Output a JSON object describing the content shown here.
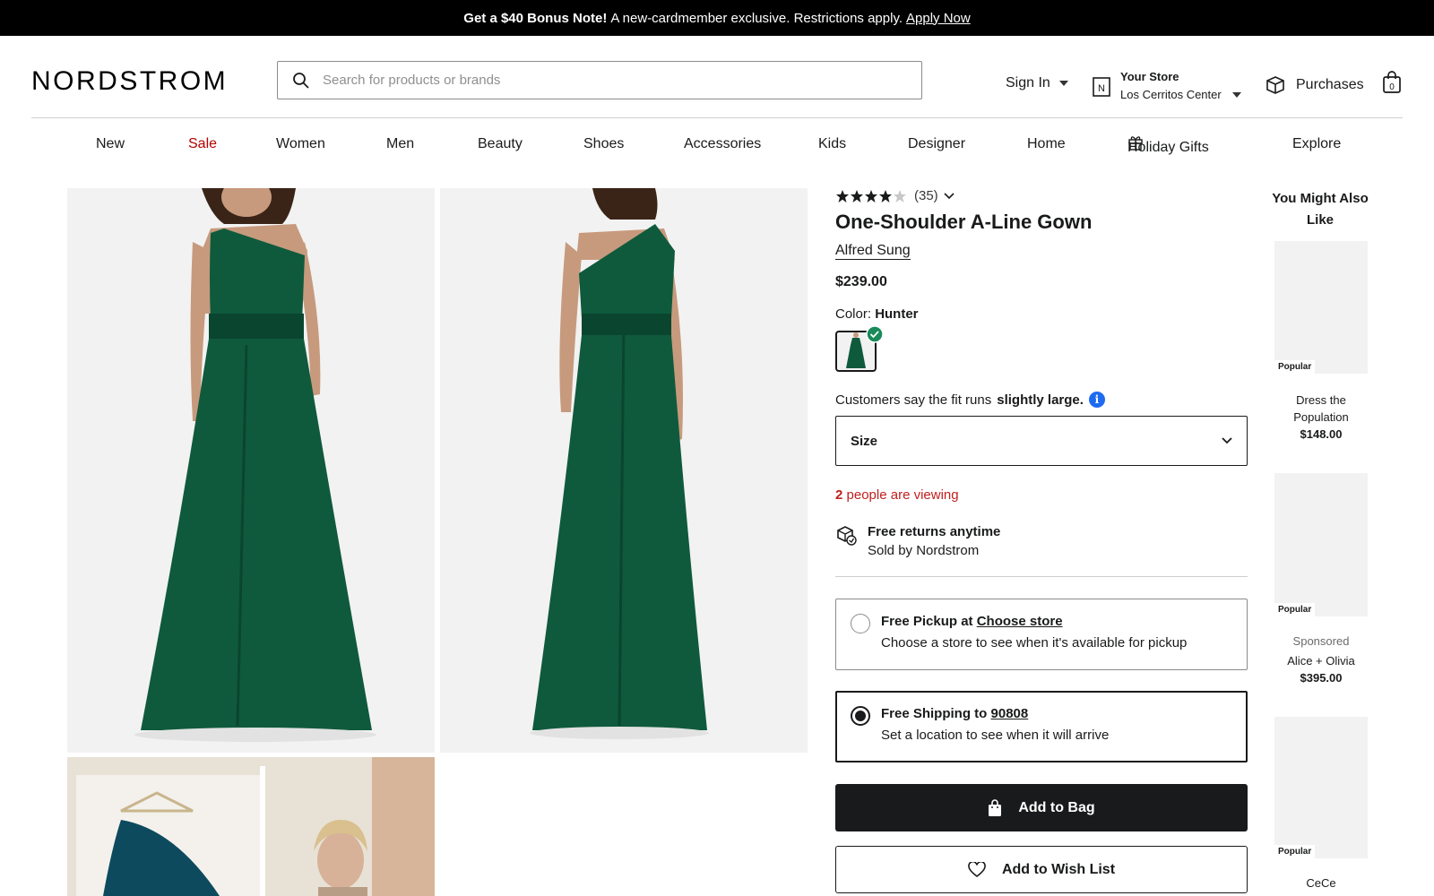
{
  "promo": {
    "bold": "Get a $40 Bonus Note!",
    "text": "A new-cardmember exclusive. Restrictions apply.",
    "link": "Apply Now"
  },
  "header": {
    "logo": "NORDSTROM",
    "search_placeholder": "Search for products or brands",
    "signin": "Sign In",
    "store_label": "Your Store",
    "store_name": "Los Cerritos Center",
    "purchases": "Purchases",
    "bag_count": "0"
  },
  "nav": {
    "items": [
      "New",
      "Sale",
      "Women",
      "Men",
      "Beauty",
      "Shoes",
      "Accessories",
      "Kids",
      "Designer",
      "Home",
      "Holiday Gifts",
      "Explore"
    ]
  },
  "product": {
    "stars": "★★★★★",
    "rating_value": 4,
    "review_count": "(35)",
    "title": "One-Shoulder A-Line Gown",
    "brand": "Alfred Sung",
    "price": "$239.00",
    "color_label": "Color:",
    "color_value": "Hunter",
    "fit_text": "Customers say the fit runs",
    "fit_bold": "slightly large.",
    "size_label": "Size",
    "viewing_count": "2",
    "viewing_text": "people are viewing",
    "returns_title": "Free returns anytime",
    "returns_sub": "Sold by Nordstrom",
    "pickup": {
      "prefix": "Free Pickup at",
      "link": "Choose store",
      "sub": "Choose a store to see when it's available for pickup"
    },
    "shipping": {
      "prefix": "Free Shipping to",
      "link": "90808",
      "sub": "Set a location to see when it will arrive"
    },
    "add_to_bag": "Add to Bag",
    "add_to_wishlist": "Add to Wish List"
  },
  "recommendations": {
    "title": "You Might Also Like",
    "items": [
      {
        "badge": "Popular",
        "sponsored": "",
        "name": "Dress the Population",
        "price": "$148.00"
      },
      {
        "badge": "Popular",
        "sponsored": "Sponsored",
        "name": "Alice + Olivia",
        "price": "$395.00"
      },
      {
        "badge": "Popular",
        "sponsored": "",
        "name": "CeCe",
        "price": ""
      }
    ]
  },
  "colors": {
    "gown": "#0f5a3c",
    "gown_dark": "#0a4530",
    "skin": "#c79a7d",
    "hair": "#3a2418",
    "sale": "#b50000",
    "viewing": "#c21e1e",
    "info": "#1f6bf0",
    "check": "#1a8a5a"
  }
}
